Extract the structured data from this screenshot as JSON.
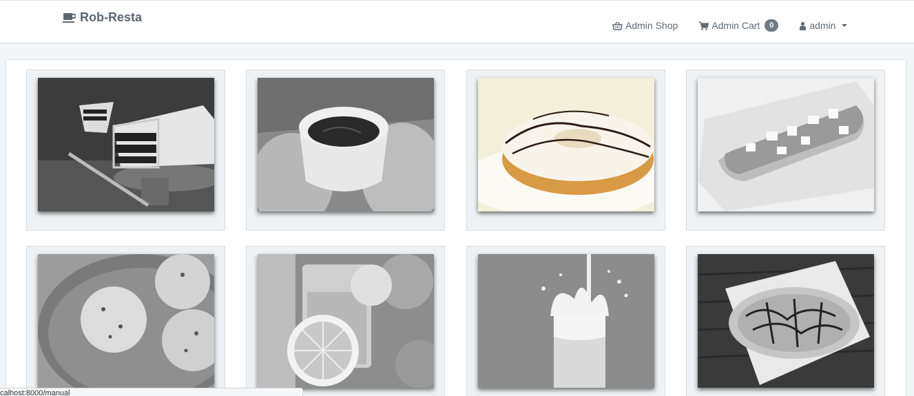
{
  "brand": {
    "name": "Rob-Resta",
    "icon": "coffee-cup-icon"
  },
  "nav": {
    "shop": {
      "label": "Admin Shop",
      "icon": "basket-icon"
    },
    "cart": {
      "label": "Admin Cart",
      "count": "0",
      "icon": "cart-icon"
    },
    "user": {
      "label": "admin",
      "icon": "user-icon"
    }
  },
  "products": [
    {
      "image": "chocolate-layer-cake"
    },
    {
      "image": "hot-drink-mug"
    },
    {
      "image": "glazed-donut"
    },
    {
      "image": "hot-dog"
    },
    {
      "image": "ice-cream-scoops"
    },
    {
      "image": "orange-juice"
    },
    {
      "image": "milk-splash"
    },
    {
      "image": "pizza"
    }
  ],
  "status": {
    "url": "calhost:8000/manual"
  },
  "colors": {
    "text": "#5f6a74",
    "badge": "#6f7a84",
    "card_bg": "#eef2f5"
  }
}
